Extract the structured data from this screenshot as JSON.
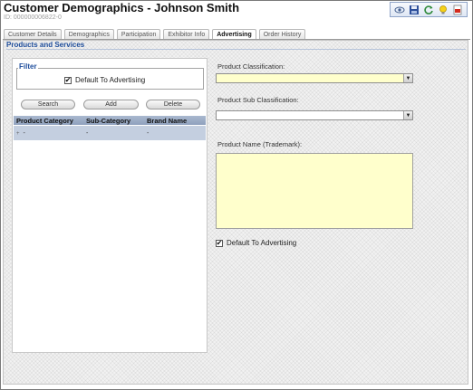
{
  "window": {
    "title": "Customer Demographics - Johnson Smith",
    "id_line": "ID: 000000006822-0"
  },
  "toolbar": {
    "icons": [
      "view-icon",
      "save-icon",
      "refresh-icon",
      "lightbulb-icon",
      "pdf-icon"
    ]
  },
  "tabs": [
    {
      "label": "Customer Details",
      "active": false
    },
    {
      "label": "Demographics",
      "active": false
    },
    {
      "label": "Participation",
      "active": false
    },
    {
      "label": "Exhibitor Info",
      "active": false
    },
    {
      "label": "Advertising",
      "active": true
    },
    {
      "label": "Order History",
      "active": false
    }
  ],
  "section": {
    "title": "Products and Services"
  },
  "filter": {
    "legend": "Filter",
    "checkbox_label": "Default To Advertising",
    "checked": true
  },
  "buttons": {
    "search": "Search",
    "add": "Add",
    "delete": "Delete"
  },
  "grid": {
    "columns": [
      "Product Category",
      "Sub-Category",
      "Brand Name"
    ],
    "rows": [
      [
        "-",
        "-",
        "-"
      ]
    ]
  },
  "form": {
    "classification_label": "Product Classification:",
    "classification_value": "",
    "sub_classification_label": "Product Sub Classification:",
    "sub_classification_value": "",
    "product_name_label": "Product Name (Trademark):",
    "product_name_value": "",
    "default_checkbox_label": "Default To Advertising",
    "default_checked": true
  },
  "colors": {
    "accent": "#1f4e9c",
    "required_field": "#ffffcc",
    "grid_header": "#a9b8cf",
    "grid_row": "#c4cfe0"
  }
}
